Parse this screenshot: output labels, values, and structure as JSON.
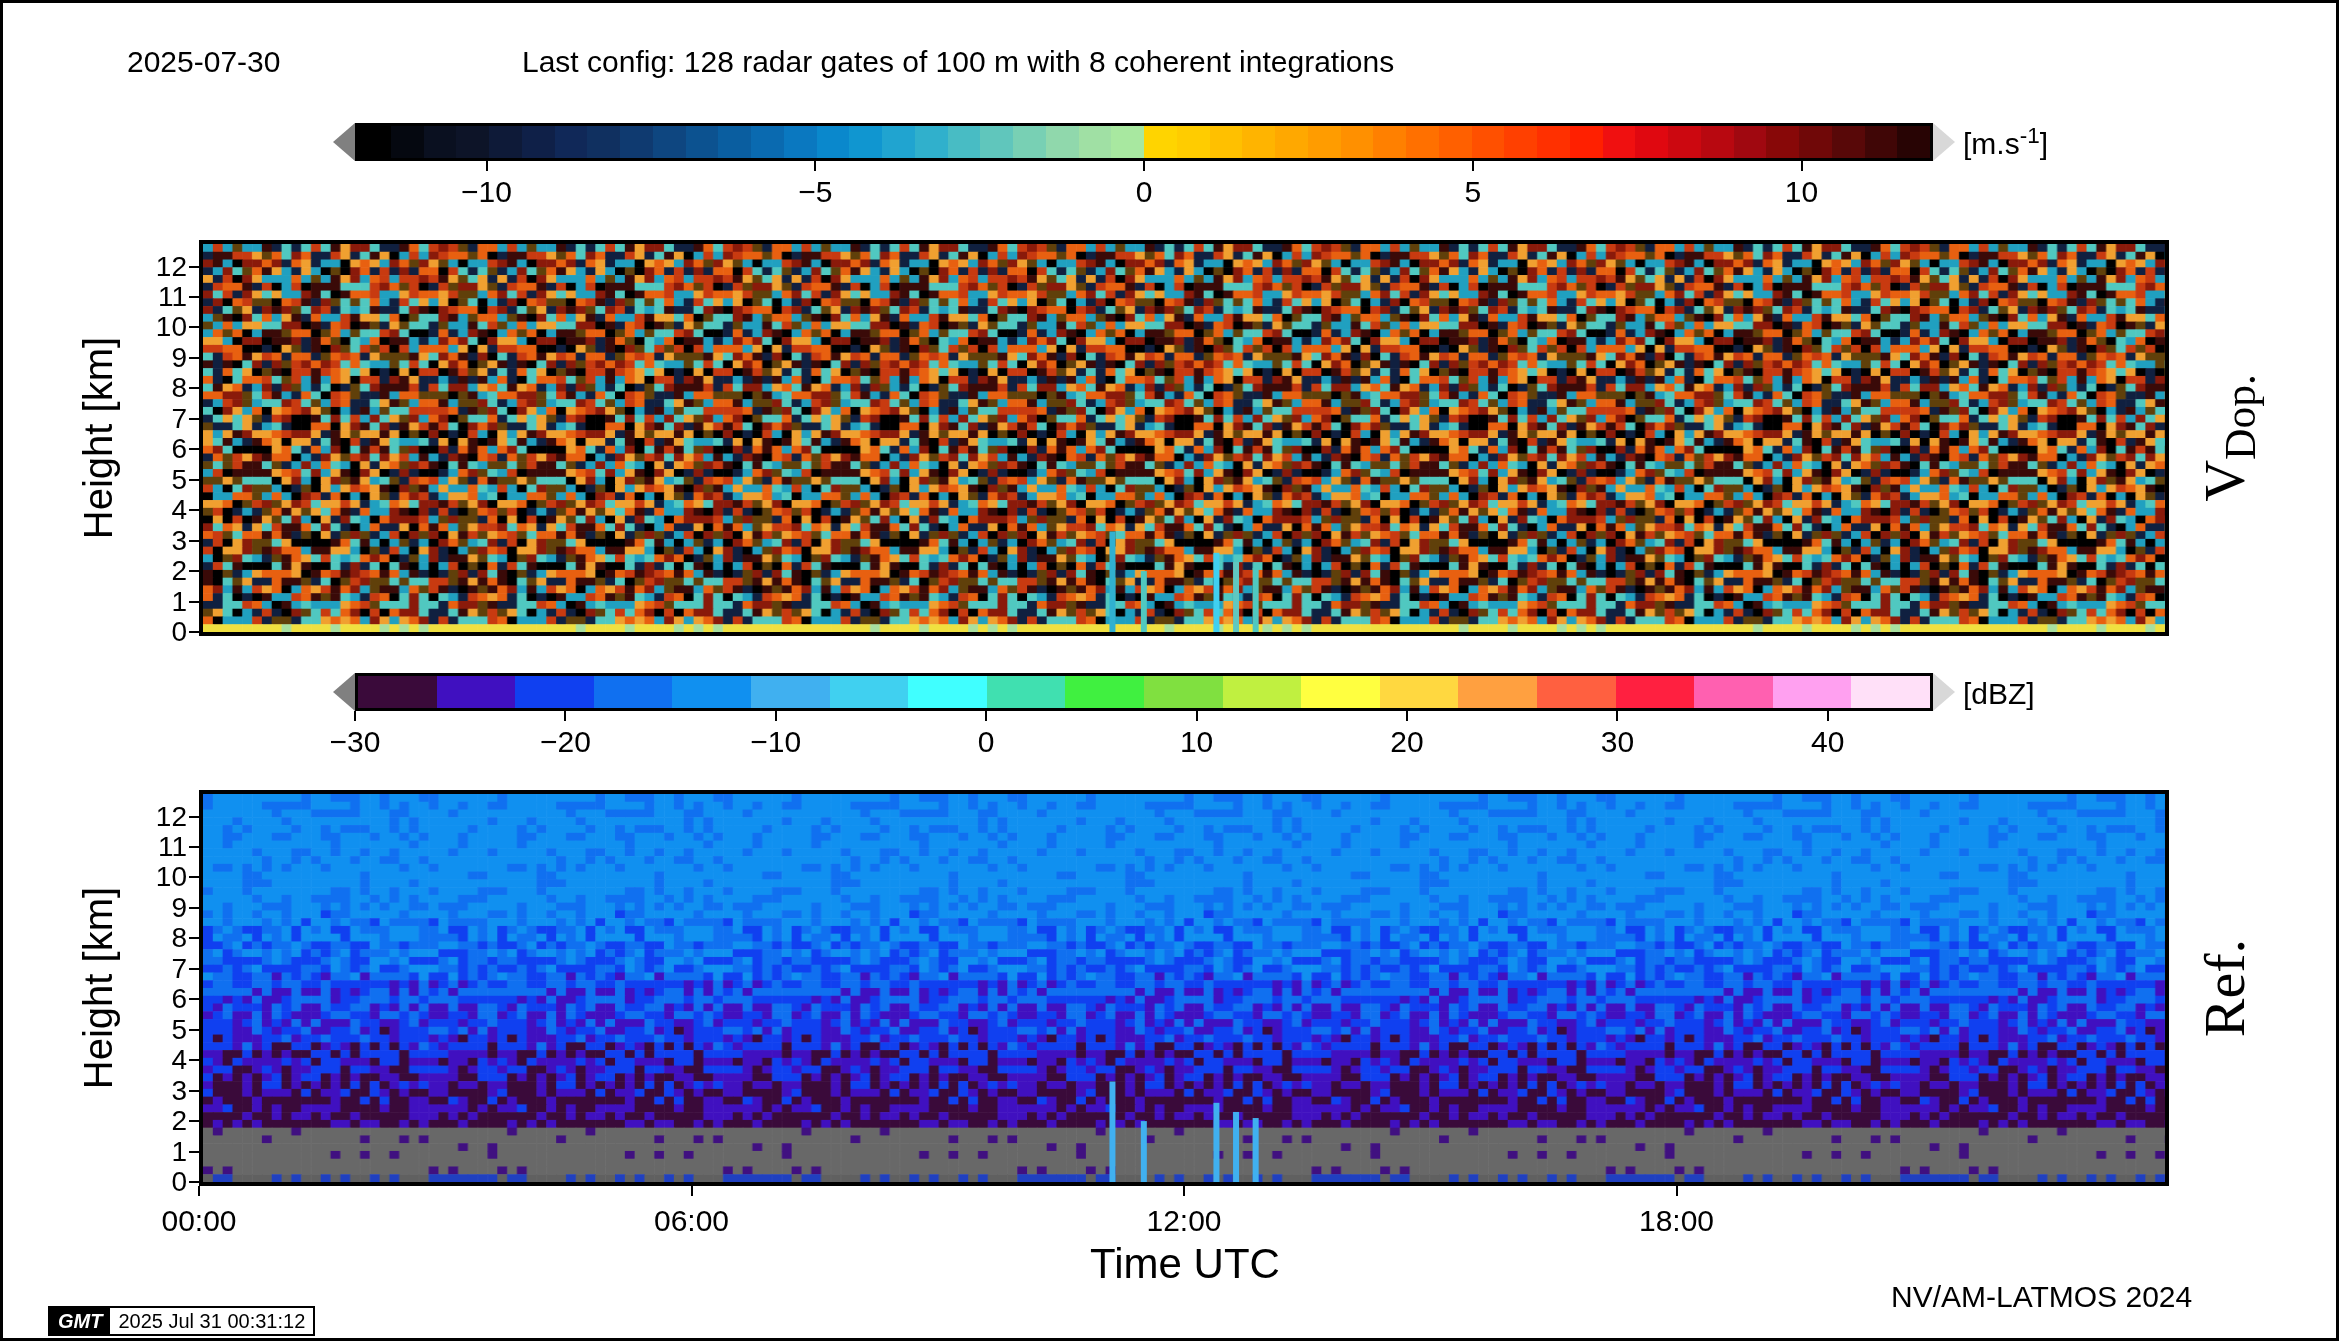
{
  "header": {
    "date": "2025-07-30",
    "config": "Last config: 128 radar gates of 100 m with 8 coherent integrations"
  },
  "colorbars": [
    {
      "unit": "[m.s$^{-1}$]",
      "ticks": [
        "−10",
        "−5",
        "0",
        "5",
        "10"
      ],
      "segments": [
        {
          "color": "#000000"
        },
        {
          "color": "#050810"
        },
        {
          "color": "#0a1020"
        },
        {
          "color": "#0d1428"
        },
        {
          "color": "#0e1a38"
        },
        {
          "color": "#0f2048"
        },
        {
          "color": "#102858"
        },
        {
          "color": "#103060"
        },
        {
          "color": "#0f3a70"
        },
        {
          "color": "#0e4680"
        },
        {
          "color": "#0c5290"
        },
        {
          "color": "#0a5ea0"
        },
        {
          "color": "#0a6ab0"
        },
        {
          "color": "#0a78c0"
        },
        {
          "color": "#0a88cc"
        },
        {
          "color": "#1096d0"
        },
        {
          "color": "#20a4d0"
        },
        {
          "color": "#30b0cc"
        },
        {
          "color": "#48bcc4"
        },
        {
          "color": "#60c6bc"
        },
        {
          "color": "#78d0b4"
        },
        {
          "color": "#90d8ac"
        },
        {
          "color": "#a0e0a4"
        },
        {
          "color": "#a8e8a0"
        },
        {
          "color": "#ffd400"
        },
        {
          "color": "#ffcc00"
        },
        {
          "color": "#ffc000"
        },
        {
          "color": "#ffb400"
        },
        {
          "color": "#ffa800"
        },
        {
          "color": "#ff9c00"
        },
        {
          "color": "#ff9000"
        },
        {
          "color": "#ff8000"
        },
        {
          "color": "#ff7000"
        },
        {
          "color": "#ff6000"
        },
        {
          "color": "#ff5000"
        },
        {
          "color": "#ff4000"
        },
        {
          "color": "#ff3000"
        },
        {
          "color": "#ff2000"
        },
        {
          "color": "#f01010"
        },
        {
          "color": "#e00810"
        },
        {
          "color": "#cc0810"
        },
        {
          "color": "#b80810"
        },
        {
          "color": "#a00810"
        },
        {
          "color": "#880808"
        },
        {
          "color": "#700808"
        },
        {
          "color": "#580808"
        },
        {
          "color": "#400606"
        },
        {
          "color": "#280404"
        }
      ]
    },
    {
      "unit": "[dBZ]",
      "ticks": [
        "−30",
        "−20",
        "−10",
        "0",
        "10",
        "20",
        "30",
        "40"
      ],
      "segments": [
        {
          "color": "#3a0a3a"
        },
        {
          "color": "#4010c0"
        },
        {
          "color": "#1040f0"
        },
        {
          "color": "#1070f0"
        },
        {
          "color": "#1090f0"
        },
        {
          "color": "#40b0f0"
        },
        {
          "color": "#40d0f0"
        },
        {
          "color": "#40ffff"
        },
        {
          "color": "#40e0b0"
        },
        {
          "color": "#40f040"
        },
        {
          "color": "#80e040"
        },
        {
          "color": "#c0f040"
        },
        {
          "color": "#ffff40"
        },
        {
          "color": "#ffd840"
        },
        {
          "color": "#ffa040"
        },
        {
          "color": "#ff6040"
        },
        {
          "color": "#ff2040"
        },
        {
          "color": "#ff60b0"
        },
        {
          "color": "#ffa0f0"
        },
        {
          "color": "#ffe0f8"
        }
      ]
    }
  ],
  "panels": [
    {
      "kind": "velocity",
      "ylabel": "Height [km]",
      "side_label": "V$_{Dop.}$",
      "yticks": [
        "12",
        "11",
        "10",
        "9",
        "8",
        "7",
        "6",
        "5",
        "4",
        "3",
        "2",
        "1",
        "0"
      ]
    },
    {
      "kind": "reflectivity",
      "ylabel": "Height [km]",
      "side_label": "Ref.",
      "yticks": [
        "12",
        "11",
        "10",
        "9",
        "8",
        "7",
        "6",
        "5",
        "4",
        "3",
        "2",
        "1",
        "0"
      ]
    }
  ],
  "xaxis": {
    "ticks": [
      "00:00",
      "06:00",
      "12:00",
      "18:00"
    ],
    "label": "Time UTC"
  },
  "credit": "NV/AM-LATMOS 2024",
  "stamp": {
    "logo": "GMT",
    "time": "2025 Jul 31 00:31:12"
  }
}
